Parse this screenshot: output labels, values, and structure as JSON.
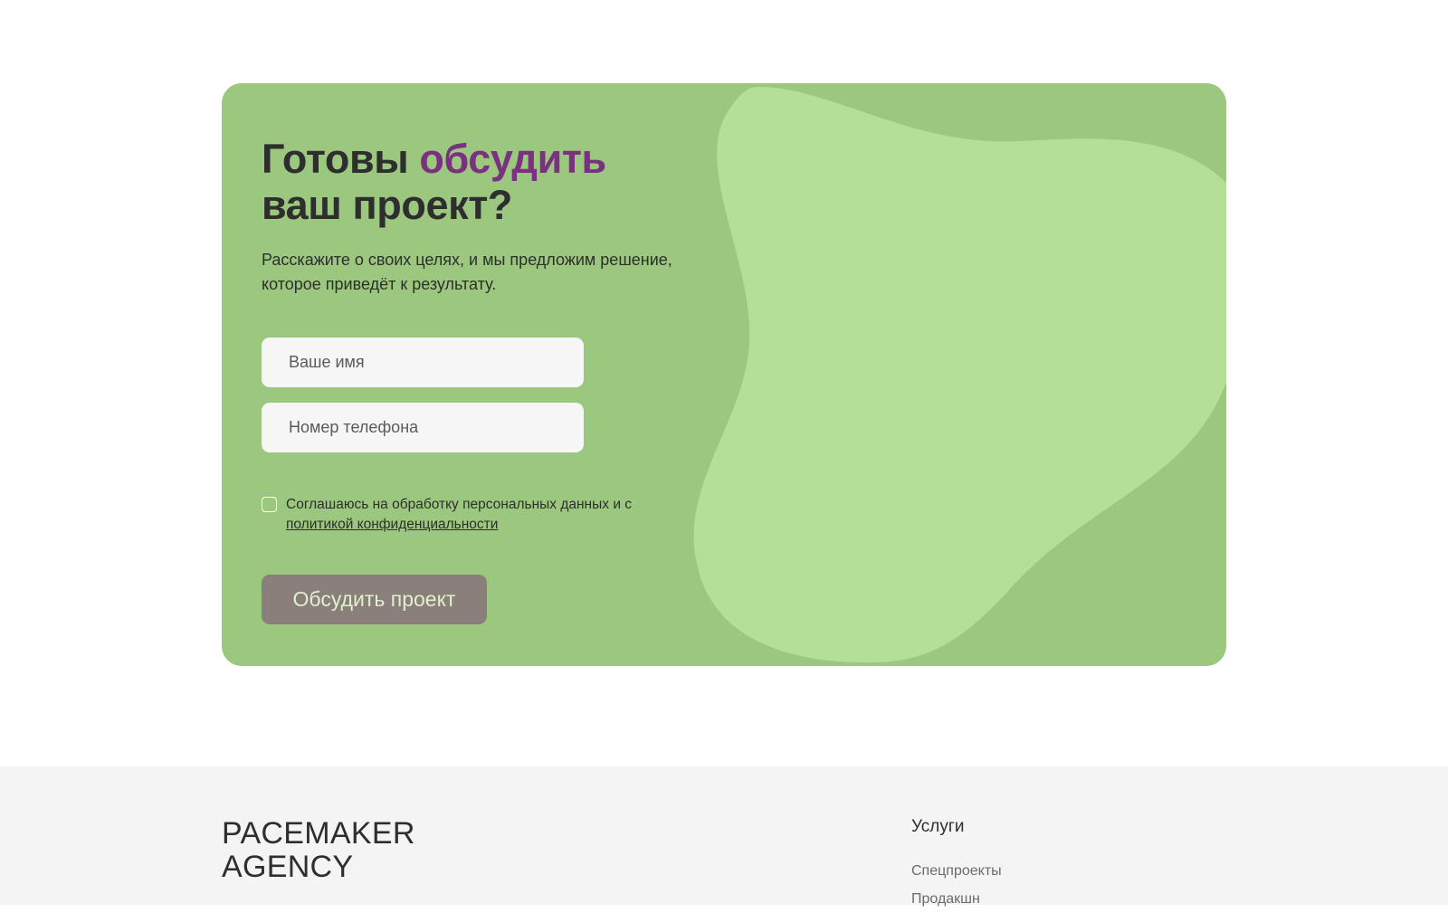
{
  "cta": {
    "title_part1": "Готовы ",
    "title_accent": "обсудить",
    "title_part2": " ваш проект?",
    "subtitle": "Расскажите о своих целях, и мы предложим решение, которое приведёт к результату.",
    "name_placeholder": "Ваше имя",
    "phone_placeholder": "Номер телефона",
    "consent_text": "Соглашаюсь на обработку персональных данных и с ",
    "consent_link": "политикой конфиденциальности",
    "consent_checked": false,
    "submit_label": "Обсудить проект"
  },
  "colors": {
    "card_bg": "#9bc77e",
    "blob": "#b3e096",
    "accent": "#7a3180",
    "button_bg": "#8a7f7b",
    "button_text": "#dff0cf",
    "footer_bg": "#f4f4f4"
  },
  "footer": {
    "logo_line1": "PACEMAKER",
    "logo_line2": "AGENCY",
    "services_heading": "Услуги",
    "services_links": [
      "Спецпроекты",
      "Продакшн"
    ]
  }
}
